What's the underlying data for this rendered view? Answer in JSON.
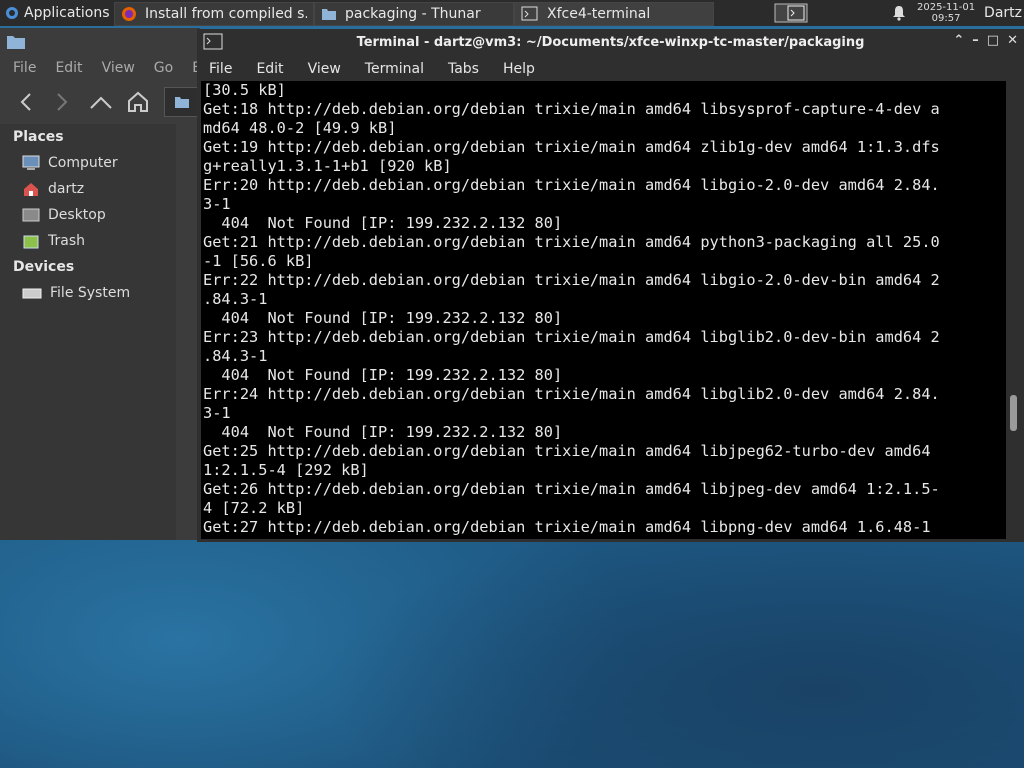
{
  "panel": {
    "apps_label": "Applications",
    "tasks": [
      {
        "label": "Install from compiled s..."
      },
      {
        "label": "packaging - Thunar"
      },
      {
        "label": "Xfce4-terminal"
      }
    ],
    "clock_date": "2025-11-01",
    "clock_time": "09:57",
    "user": "Dartz"
  },
  "thunar": {
    "menu": [
      "File",
      "Edit",
      "View",
      "Go",
      "Boo"
    ],
    "places_header": "Places",
    "places": [
      "Computer",
      "dartz",
      "Desktop",
      "Trash"
    ],
    "devices_header": "Devices",
    "devices": [
      "File System"
    ]
  },
  "terminal": {
    "title": "Terminal - dartz@vm3: ~/Documents/xfce-winxp-tc-master/packaging",
    "menu": [
      "File",
      "Edit",
      "View",
      "Terminal",
      "Tabs",
      "Help"
    ],
    "lines": [
      "[30.5 kB]",
      "Get:18 http://deb.debian.org/debian trixie/main amd64 libsysprof-capture-4-dev a",
      "md64 48.0-2 [49.9 kB]",
      "Get:19 http://deb.debian.org/debian trixie/main amd64 zlib1g-dev amd64 1:1.3.dfs",
      "g+really1.3.1-1+b1 [920 kB]",
      "Err:20 http://deb.debian.org/debian trixie/main amd64 libgio-2.0-dev amd64 2.84.",
      "3-1",
      "  404  Not Found [IP: 199.232.2.132 80]",
      "Get:21 http://deb.debian.org/debian trixie/main amd64 python3-packaging all 25.0",
      "-1 [56.6 kB]",
      "Err:22 http://deb.debian.org/debian trixie/main amd64 libgio-2.0-dev-bin amd64 2",
      ".84.3-1",
      "  404  Not Found [IP: 199.232.2.132 80]",
      "Err:23 http://deb.debian.org/debian trixie/main amd64 libglib2.0-dev-bin amd64 2",
      ".84.3-1",
      "  404  Not Found [IP: 199.232.2.132 80]",
      "Err:24 http://deb.debian.org/debian trixie/main amd64 libglib2.0-dev amd64 2.84.",
      "3-1",
      "  404  Not Found [IP: 199.232.2.132 80]",
      "Get:25 http://deb.debian.org/debian trixie/main amd64 libjpeg62-turbo-dev amd64",
      "1:2.1.5-4 [292 kB]",
      "Get:26 http://deb.debian.org/debian trixie/main amd64 libjpeg-dev amd64 1:2.1.5-",
      "4 [72.2 kB]",
      "Get:27 http://deb.debian.org/debian trixie/main amd64 libpng-dev amd64 1.6.48-1"
    ]
  },
  "colors": {
    "panel": "#2b2b2b",
    "terminal_bg": "#000000",
    "accent": "#1f5f8c"
  }
}
